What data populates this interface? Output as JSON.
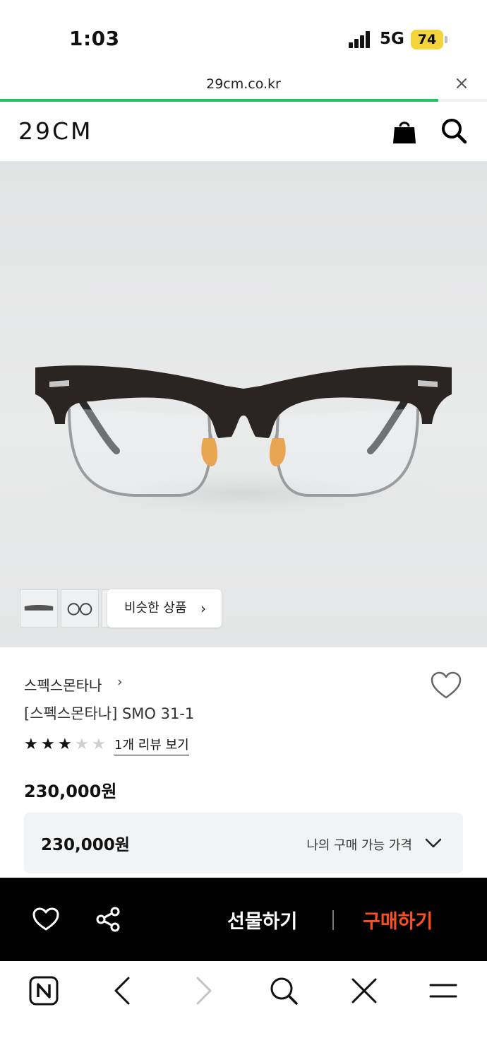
{
  "status_bar": {
    "time": "1:03",
    "network": "5G",
    "battery": "74",
    "battery_color": "#f3d43b"
  },
  "browser": {
    "url": "29cm.co.kr",
    "load_progress": 0.9,
    "progress_color": "#22c55e"
  },
  "header": {
    "logo": "29CM",
    "icons": [
      "shopping-bag-icon",
      "search-icon"
    ]
  },
  "gallery": {
    "similar_label": "비슷한 상품",
    "similar_chevron": "›",
    "thumbnail_count": 3
  },
  "product": {
    "brand": "스펙스몬타나",
    "brand_chevron": "›",
    "name": "[스펙스몬타나] SMO 31-1",
    "rating": 3,
    "rating_max": 5,
    "review_link": "1개 리뷰 보기",
    "price": "230,000원",
    "price_box": {
      "value": "230,000원",
      "label": "나의 구매 가능 가격"
    }
  },
  "action_bar": {
    "gift_label": "선물하기",
    "buy_label": "구매하기",
    "buy_color": "#ff4f1f",
    "icons": [
      "heart-icon",
      "share-icon"
    ]
  },
  "browser_toolbar": {
    "icons": [
      "naver-home-icon",
      "back-arrow-icon",
      "forward-arrow-icon",
      "search-icon",
      "close-icon",
      "menu-icon"
    ]
  }
}
